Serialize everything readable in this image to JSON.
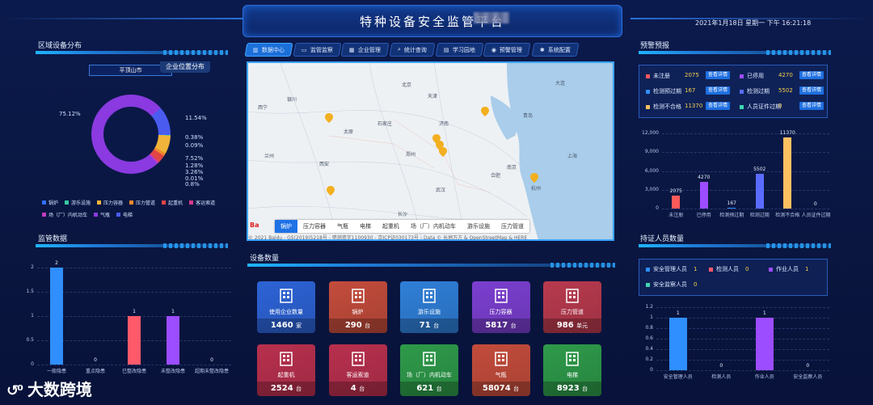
{
  "header": {
    "title": "特种设备安全监管平台",
    "datetime": "2021年1月18日 星期一 下午 16:21:18"
  },
  "nav": {
    "tabs": [
      {
        "label": "数据中心",
        "icon": "chart-icon",
        "active": true
      },
      {
        "label": "监管监察",
        "icon": "monitor-icon",
        "active": false
      },
      {
        "label": "企业管理",
        "icon": "building-icon",
        "active": false
      },
      {
        "label": "统计查询",
        "icon": "search-user-icon",
        "active": false
      },
      {
        "label": "学习园地",
        "icon": "book-icon",
        "active": false
      },
      {
        "label": "预警管理",
        "icon": "alert-icon",
        "active": false
      },
      {
        "label": "系统配置",
        "icon": "gear-icon",
        "active": false
      }
    ]
  },
  "region": {
    "title": "区域设备分布",
    "selected_city": "平顶山市",
    "percentages": [
      "75.12%",
      "11.54%",
      "0.38%",
      "0.09%",
      "7.52%",
      "1.28%",
      "3.26%",
      "0.01%",
      "0.8%"
    ],
    "legend": [
      {
        "name": "锅炉",
        "color": "#2f6fff"
      },
      {
        "name": "游乐设施",
        "color": "#35c9a4"
      },
      {
        "name": "压力容器",
        "color": "#f0b43a"
      },
      {
        "name": "压力管道",
        "color": "#ef8a2d"
      },
      {
        "name": "起重机",
        "color": "#e24545"
      },
      {
        "name": "客运索道",
        "color": "#d63b8a"
      },
      {
        "name": "场（厂）内机动车",
        "color": "#c23cbf"
      },
      {
        "name": "气瓶",
        "color": "#8a3ae0"
      },
      {
        "name": "电梯",
        "color": "#4a5cf0"
      }
    ]
  },
  "chart_data": [
    {
      "type": "pie",
      "title": "区域设备分布",
      "categories": [
        "锅炉",
        "游乐设施",
        "压力容器",
        "压力管道",
        "起重机",
        "客运索道",
        "场（厂）内机动车",
        "气瓶",
        "电梯"
      ],
      "values": [
        0.38,
        0.09,
        7.52,
        1.28,
        3.26,
        0.01,
        0.8,
        75.12,
        11.54
      ]
    },
    {
      "type": "bar",
      "title": "监管数据",
      "categories": [
        "一般隐患",
        "重点隐患",
        "已整改隐患",
        "未整改隐患",
        "超期未整改隐患"
      ],
      "values": [
        2,
        0,
        1,
        1,
        0
      ],
      "ylim": [
        0,
        2
      ]
    },
    {
      "type": "bar",
      "title": "预警预报",
      "categories": [
        "未注册",
        "已停用",
        "检测预过期",
        "检测过期",
        "检测不合格",
        "人员证件过期"
      ],
      "values": [
        2075,
        4270,
        167,
        5502,
        11370,
        0
      ],
      "ylim": [
        0,
        12000
      ]
    },
    {
      "type": "bar",
      "title": "持证人员数量",
      "categories": [
        "安全管理人员",
        "检测人员",
        "作业人员",
        "安全监察人员"
      ],
      "values": [
        1,
        0,
        1,
        0
      ],
      "ylim": [
        0,
        1.2
      ]
    }
  ],
  "supervision": {
    "title": "监管数据",
    "y_ticks": [
      "2",
      "1.5",
      "1",
      "0.5",
      "0"
    ],
    "labels": [
      "一般隐患",
      "重点隐患",
      "已整改隐患",
      "未整改隐患",
      "超期未整改隐患"
    ],
    "values": [
      "2",
      "0",
      "1",
      "1",
      "0"
    ]
  },
  "map": {
    "title": "企业位置分布",
    "tabs": [
      "锅炉",
      "压力容器",
      "气瓶",
      "电梯",
      "起重机",
      "场（厂）内机动车",
      "游乐设施",
      "压力管道"
    ],
    "copyright": "© 2021 Baidu - GS(2019)5218号 - 甲测资字1100930 - 京ICP证030173号 - Data © 长地万方 & OpenStreetMap & HERE",
    "cities": [
      "北京",
      "天津",
      "石家庄",
      "太原",
      "济南",
      "郑州",
      "西安",
      "南京",
      "合肥",
      "武汉",
      "上海",
      "杭州",
      "兰州",
      "西宁",
      "银川",
      "青岛",
      "大连",
      "长沙"
    ]
  },
  "equipment": {
    "title": "设备数量",
    "cards": [
      {
        "label": "使用企业数量",
        "value": "1460",
        "unit": "家",
        "icon": "building-icon",
        "color": "#2d63d6"
      },
      {
        "label": "锅炉",
        "value": "290",
        "unit": "台",
        "icon": "boiler-icon",
        "color": "#c34c3c"
      },
      {
        "label": "游乐设施",
        "value": "71",
        "unit": "台",
        "icon": "carousel-icon",
        "color": "#2f7fd8"
      },
      {
        "label": "压力容器",
        "value": "5817",
        "unit": "台",
        "icon": "tank-icon",
        "color": "#7b3fd0"
      },
      {
        "label": "压力管道",
        "value": "986",
        "unit": "单元",
        "icon": "pipe-icon",
        "color": "#b83a4e"
      },
      {
        "label": "起重机",
        "value": "2524",
        "unit": "台",
        "icon": "crane-icon",
        "color": "#b8304e"
      },
      {
        "label": "客运索道",
        "value": "4",
        "unit": "台",
        "icon": "cablecar-icon",
        "color": "#b8304e"
      },
      {
        "label": "场（厂）内机动车",
        "value": "621",
        "unit": "台",
        "icon": "forklift-icon",
        "color": "#2e9a4a"
      },
      {
        "label": "气瓶",
        "value": "58074",
        "unit": "台",
        "icon": "cylinder-icon",
        "color": "#c34c3c"
      },
      {
        "label": "电梯",
        "value": "8923",
        "unit": "台",
        "icon": "elevator-icon",
        "color": "#2e9a4a"
      }
    ]
  },
  "warning": {
    "title": "预警预报",
    "items": [
      {
        "label": "未注册",
        "value": "2075",
        "color": "#ff5a5a"
      },
      {
        "label": "已停用",
        "value": "4270",
        "color": "#9b4dff"
      },
      {
        "label": "检测预过期",
        "value": "167",
        "color": "#2f8fff"
      },
      {
        "label": "检测过期",
        "value": "5502",
        "color": "#5a6cff"
      },
      {
        "label": "检测不合格",
        "value": "11370",
        "color": "#ffc060"
      },
      {
        "label": "人员证件过期",
        "value": "0",
        "color": "#3fd6b0"
      }
    ],
    "detail_label": "查看详情",
    "y_ticks": [
      "12,000",
      "9,000",
      "6,000",
      "3,000",
      "0"
    ],
    "labels": [
      "未注册",
      "已停用",
      "检测预过期",
      "检测过期",
      "检测不合格",
      "人员证件过期"
    ],
    "values": [
      "2075",
      "4270",
      "167",
      "5502",
      "11370",
      "0"
    ]
  },
  "personnel": {
    "title": "持证人员数量",
    "items": [
      {
        "label": "安全管理人员",
        "value": "1",
        "color": "#2f8fff"
      },
      {
        "label": "检测人员",
        "value": "0",
        "color": "#ff5a6a"
      },
      {
        "label": "作业人员",
        "value": "1",
        "color": "#9b4dff"
      },
      {
        "label": "安全监察人员",
        "value": "0",
        "color": "#3fd6b0"
      }
    ],
    "y_ticks": [
      "1.2",
      "1",
      "0.8",
      "0.6",
      "0.4",
      "0.2",
      "0"
    ],
    "labels": [
      "安全管理人员",
      "检测人员",
      "作业人员",
      "安全监察人员"
    ],
    "values": [
      "1",
      "0",
      "1",
      "0"
    ]
  },
  "brand": {
    "logo_text": "大数跨境"
  }
}
